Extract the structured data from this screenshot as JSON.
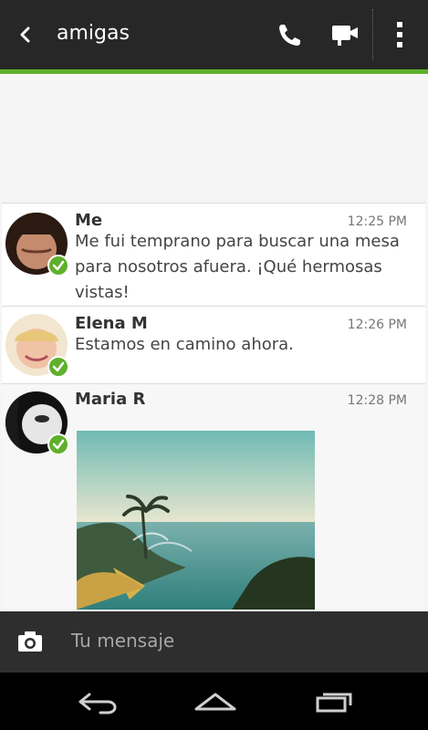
{
  "header": {
    "title": "amigas"
  },
  "messages": [
    {
      "sender": "Me",
      "time": "12:25 PM",
      "text": "Me fui temprano para buscar una mesa para nosotros afuera. ¡Qué hermosas vistas!"
    },
    {
      "sender": "Elena M",
      "time": "12:26 PM",
      "text": "Estamos en camino ahora."
    },
    {
      "sender": "Maria R",
      "time": "12:28 PM",
      "text": ""
    }
  ],
  "composer": {
    "placeholder": "Tu mensaje"
  },
  "icons": {
    "back": "chevron-left-icon",
    "call": "phone-icon",
    "video": "video-camera-icon",
    "menu": "kebab-menu-icon",
    "camera": "camera-icon",
    "nav_back": "android-back-icon",
    "nav_home": "android-home-icon",
    "nav_recents": "android-recents-icon"
  },
  "colors": {
    "accent": "#5fb02c",
    "topbar": "#272727",
    "composer": "#2e2e2e"
  }
}
